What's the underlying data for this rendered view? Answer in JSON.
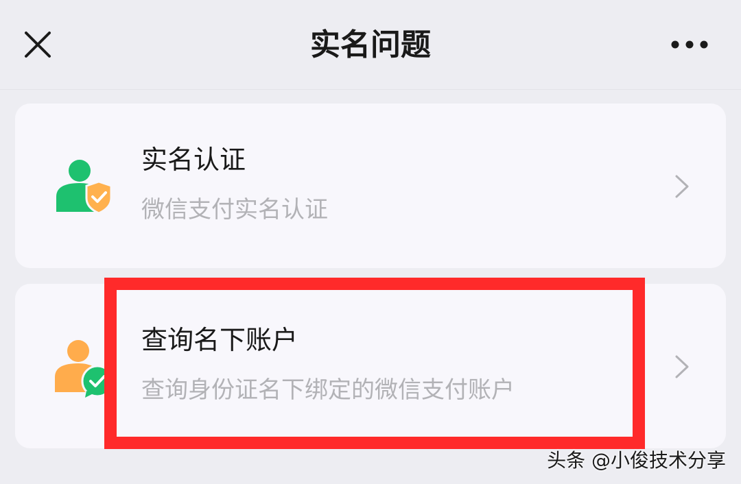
{
  "nav": {
    "title": "实名问题",
    "close_icon": "close-icon",
    "more_icon": "more-horizontal-icon"
  },
  "cards": [
    {
      "title": "实名认证",
      "subtitle": "微信支付实名认证",
      "icon": "user-verified-shield-icon",
      "icon_colors": {
        "person": "#1ec16f",
        "badge": "#ffb14e"
      }
    },
    {
      "title": "查询名下账户",
      "subtitle": "查询身份证名下绑定的微信支付账户",
      "icon": "user-check-chat-icon",
      "icon_colors": {
        "person": "#ffac4c",
        "badge": "#1ec16f"
      }
    }
  ],
  "highlight": {
    "color": "#ff2a2a",
    "target": "查询名下账户"
  },
  "watermark": {
    "text": "头条 @小俊技术分享"
  }
}
